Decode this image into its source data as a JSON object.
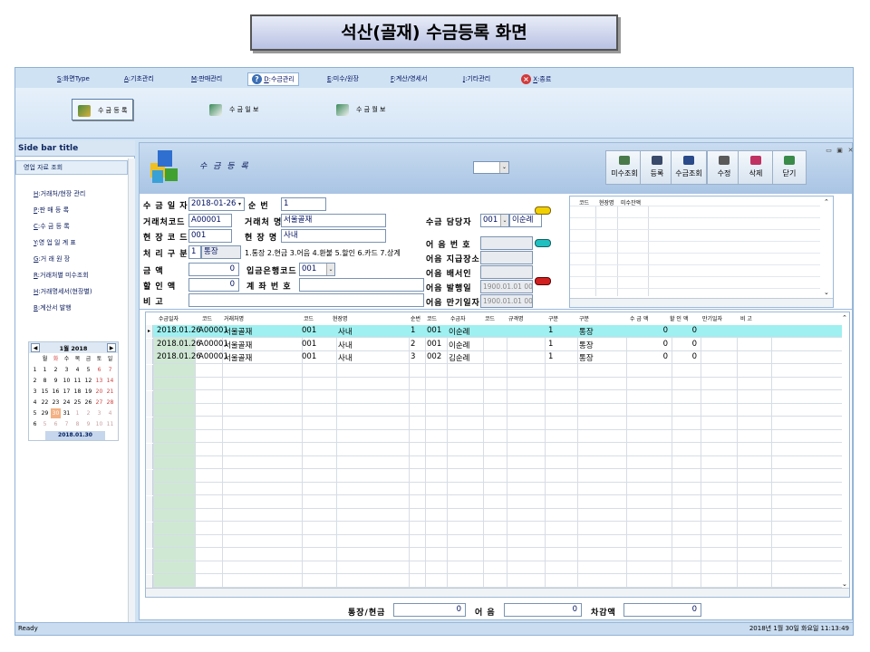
{
  "slide_title": "석산(골재) 수금등록 화면",
  "menu": [
    {
      "key": "S",
      "label": ":화면Type"
    },
    {
      "key": "A",
      "label": ":기초관리"
    },
    {
      "key": "M",
      "label": ":판매관리"
    },
    {
      "key": "D",
      "label": ":수금관리"
    },
    {
      "key": "E",
      "label": ":미수/원장"
    },
    {
      "key": "F",
      "label": ":계산/영세서"
    },
    {
      "key": "J",
      "label": ":기타관리"
    },
    {
      "key": "X",
      "label": ":종료"
    }
  ],
  "ribbon": [
    "수 금 등 록",
    "수 금 일 보",
    "수 금 월 보"
  ],
  "sidebar": {
    "title": "Side bar title",
    "section": "영업 자료 조회",
    "links": [
      {
        "key": "H",
        "label": ":거래처/현장 관리"
      },
      {
        "key": "P",
        "label": ":판 매 등 록"
      },
      {
        "key": "C",
        "label": ":수 금 등 록"
      },
      {
        "key": "Y",
        "label": ":영 업 일 계 표"
      },
      {
        "key": "G",
        "label": ":거 래 원 장"
      },
      {
        "key": "R",
        "label": ":거래처별 미수조회"
      },
      {
        "key": "H",
        "label": ":거래명세서(현장별)"
      },
      {
        "key": "B",
        "label": ":계산서 발행"
      }
    ]
  },
  "calendar": {
    "title": "1월 2018",
    "weekdays": [
      "월",
      "화",
      "수",
      "목",
      "금",
      "토",
      "일"
    ],
    "weeks": [
      {
        "wk": "1",
        "days": [
          "1",
          "2",
          "3",
          "4",
          "5",
          "6",
          "7"
        ]
      },
      {
        "wk": "2",
        "days": [
          "8",
          "9",
          "10",
          "11",
          "12",
          "13",
          "14"
        ]
      },
      {
        "wk": "3",
        "days": [
          "15",
          "16",
          "17",
          "18",
          "19",
          "20",
          "21"
        ]
      },
      {
        "wk": "4",
        "days": [
          "22",
          "23",
          "24",
          "25",
          "26",
          "27",
          "28"
        ]
      },
      {
        "wk": "5",
        "days": [
          "29",
          "30",
          "31",
          "1",
          "2",
          "3",
          "4"
        ]
      },
      {
        "wk": "6",
        "days": [
          "5",
          "6",
          "7",
          "8",
          "9",
          "10",
          "11"
        ]
      }
    ],
    "today": "2018.01.30"
  },
  "screen_title": "수 금 등 록",
  "toolbar": [
    "미수조회",
    "등록",
    "수금조회",
    "수정",
    "삭제",
    "닫기"
  ],
  "form": {
    "date_label": "수 금 일 자",
    "date_value": "2018-01-26",
    "seq_label": "순     번",
    "seq_value": "1",
    "client_code_label": "거래처코드",
    "client_code_value": "A00001",
    "client_name_label": "거래처 명",
    "client_name_value": "서울골재",
    "site_code_label": "현 장 코 드",
    "site_code_value": "001",
    "site_name_label": "현  장  명",
    "site_name_value": "사내",
    "type_label": "처 리 구 분",
    "type_code": "1",
    "type_value": "통장",
    "type_hint": "1.통장 2.현금 3.어음 4.환불 5.할인 6.카드 7.상계",
    "amount_label": "금      액",
    "amount_value": "0",
    "bank_label": "입금은행코드",
    "bank_value": "001",
    "discount_label": "할  인  액",
    "discount_value": "0",
    "account_label": "계 좌 번 호",
    "account_value": "",
    "memo_label": "비      고",
    "memo_value": "",
    "manager_label": "수금 담당자",
    "manager_code": "001",
    "manager_name": "이순례",
    "note_no_label": "어 음 번 호",
    "note_place_label": "어음 지급장소",
    "note_endorser_label": "어음 배서인",
    "note_issue_label": "어음 발행일",
    "note_issue_value": "1900.01.01 00:",
    "note_due_label": "어음 만기일자",
    "note_due_value": "1900.01.01 00:"
  },
  "mini_grid": {
    "headers": [
      "코드",
      "현장명",
      "미수잔액"
    ]
  },
  "grid": {
    "headers": [
      "수금일자",
      "코드",
      "거래처명",
      "코드",
      "현장명",
      "순번",
      "코드",
      "수금자",
      "코드",
      "규격명",
      "구분",
      "구분",
      "수 금 액",
      "할 인 액",
      "만기일자",
      "비 고"
    ],
    "rows": [
      [
        "2018.01.26",
        "A00001",
        "서울골재",
        "001",
        "사내",
        "1",
        "001",
        "이순례",
        "",
        "",
        "1",
        "통장",
        "0",
        "0",
        "",
        ""
      ],
      [
        "2018.01.26",
        "A00001",
        "서울골재",
        "001",
        "사내",
        "2",
        "001",
        "이순례",
        "",
        "",
        "1",
        "통장",
        "0",
        "0",
        "",
        ""
      ],
      [
        "2018.01.26",
        "A00001",
        "서울골재",
        "001",
        "사내",
        "3",
        "002",
        "김순례",
        "",
        "",
        "1",
        "통장",
        "0",
        "0",
        "",
        ""
      ]
    ]
  },
  "totals": {
    "bank_cash_label": "통장/현금",
    "bank_cash_value": "0",
    "note_label": "어  음",
    "note_value": "0",
    "offset_label": "차감액",
    "offset_value": "0"
  },
  "status": {
    "left": "Ready",
    "right": "2018년 1월 30일 화요일 11:13:49"
  },
  "colors": {
    "selected_row": "#9ff0f0",
    "frame": "#cfe2f3",
    "today": "#f4b183"
  }
}
